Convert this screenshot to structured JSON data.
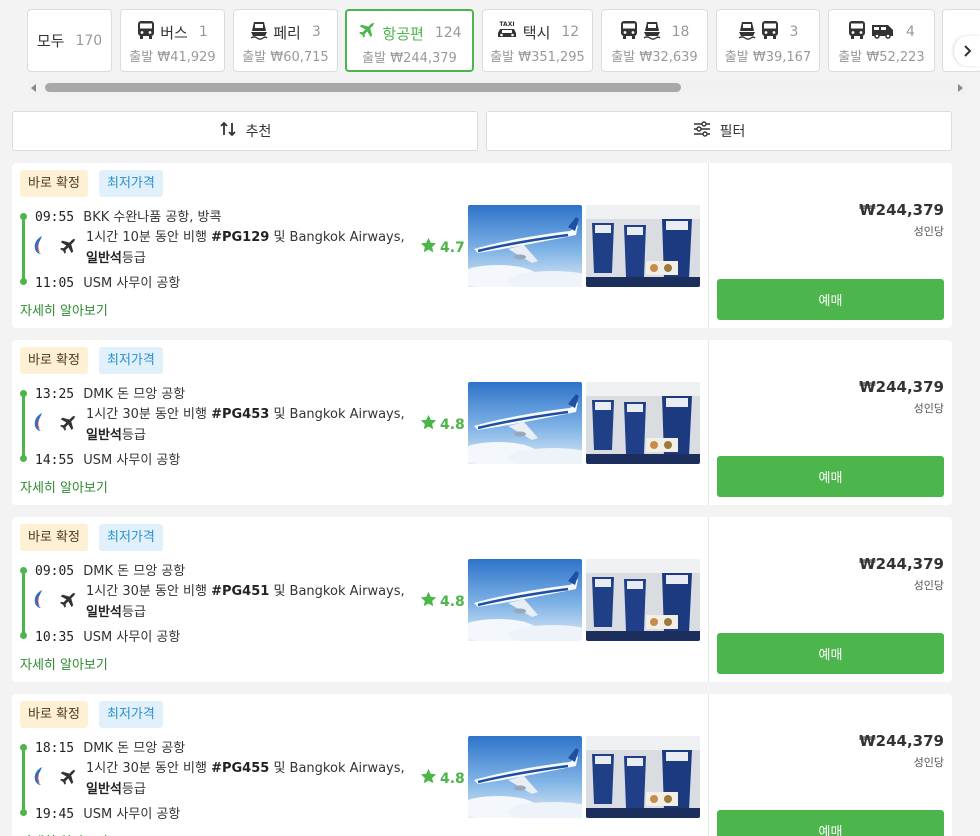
{
  "tabs": [
    {
      "key": "all",
      "label": "모두",
      "count": "170",
      "price": "",
      "icons": []
    },
    {
      "key": "bus",
      "label": "버스",
      "count": "1",
      "price": "출발 ₩41,929",
      "icons": [
        "bus-icon"
      ]
    },
    {
      "key": "ferry",
      "label": "페리",
      "count": "3",
      "price": "출발 ₩60,715",
      "icons": [
        "ferry-icon"
      ]
    },
    {
      "key": "flight",
      "label": "항공편",
      "count": "124",
      "price": "출발 ₩244,379",
      "icons": [
        "airplane-icon"
      ],
      "active": true
    },
    {
      "key": "taxi",
      "label": "택시",
      "count": "12",
      "price": "출발 ₩351,295",
      "icons": [
        "taxi-icon"
      ]
    },
    {
      "key": "bus-ferry",
      "label": "",
      "count": "18",
      "price": "출발 ₩32,639",
      "icons": [
        "bus-icon",
        "ferry-icon"
      ]
    },
    {
      "key": "ferry-bus",
      "label": "",
      "count": "3",
      "price": "출발 ₩39,167",
      "icons": [
        "ferry-icon",
        "bus-icon"
      ]
    },
    {
      "key": "bus-van",
      "label": "",
      "count": "4",
      "price": "출발 ₩52,223",
      "icons": [
        "bus-icon",
        "van-icon"
      ]
    }
  ],
  "controls": {
    "sort_label": "추천",
    "filter_label": "필터"
  },
  "scrollbar": {
    "position": 0.0
  },
  "colors": {
    "accent": "#4cb64c",
    "lowest_badge_text": "#2a8fd0",
    "confirm_badge_bg": "#fdf0d4"
  },
  "results": [
    {
      "badge_confirm": "바로 확정",
      "badge_lowest": "최저가격",
      "dep_time": "09:55",
      "dep_place": "BKK 수완나품 공항, 방콕",
      "duration": "1시간 10분 동안 비행",
      "flight_no": "#PG129",
      "carrier": "및 Bangkok Airways,",
      "class_bold": "일반석",
      "class_suffix": "등급",
      "rating": "4.7",
      "arr_time": "11:05",
      "arr_place": "USM 사무이 공항",
      "more": "자세히 알아보기",
      "price": "₩244,379",
      "price_unit": "성인당",
      "book": "예매"
    },
    {
      "badge_confirm": "바로 확정",
      "badge_lowest": "최저가격",
      "dep_time": "13:25",
      "dep_place": "DMK 돈 므앙 공항",
      "duration": "1시간 30분 동안 비행",
      "flight_no": "#PG453",
      "carrier": "및 Bangkok Airways,",
      "class_bold": "일반석",
      "class_suffix": "등급",
      "rating": "4.8",
      "arr_time": "14:55",
      "arr_place": "USM 사무이 공항",
      "more": "자세히 알아보기",
      "price": "₩244,379",
      "price_unit": "성인당",
      "book": "예매"
    },
    {
      "badge_confirm": "바로 확정",
      "badge_lowest": "최저가격",
      "dep_time": "09:05",
      "dep_place": "DMK 돈 므앙 공항",
      "duration": "1시간 30분 동안 비행",
      "flight_no": "#PG451",
      "carrier": "및 Bangkok Airways,",
      "class_bold": "일반석",
      "class_suffix": "등급",
      "rating": "4.8",
      "arr_time": "10:35",
      "arr_place": "USM 사무이 공항",
      "more": "자세히 알아보기",
      "price": "₩244,379",
      "price_unit": "성인당",
      "book": "예매"
    },
    {
      "badge_confirm": "바로 확정",
      "badge_lowest": "최저가격",
      "dep_time": "18:15",
      "dep_place": "DMK 돈 므앙 공항",
      "duration": "1시간 30분 동안 비행",
      "flight_no": "#PG455",
      "carrier": "및 Bangkok Airways,",
      "class_bold": "일반석",
      "class_suffix": "등급",
      "rating": "4.8",
      "arr_time": "19:45",
      "arr_place": "USM 사무이 공항",
      "more": "자세히 알아보기",
      "price": "₩244,379",
      "price_unit": "성인당",
      "book": "예매"
    }
  ]
}
